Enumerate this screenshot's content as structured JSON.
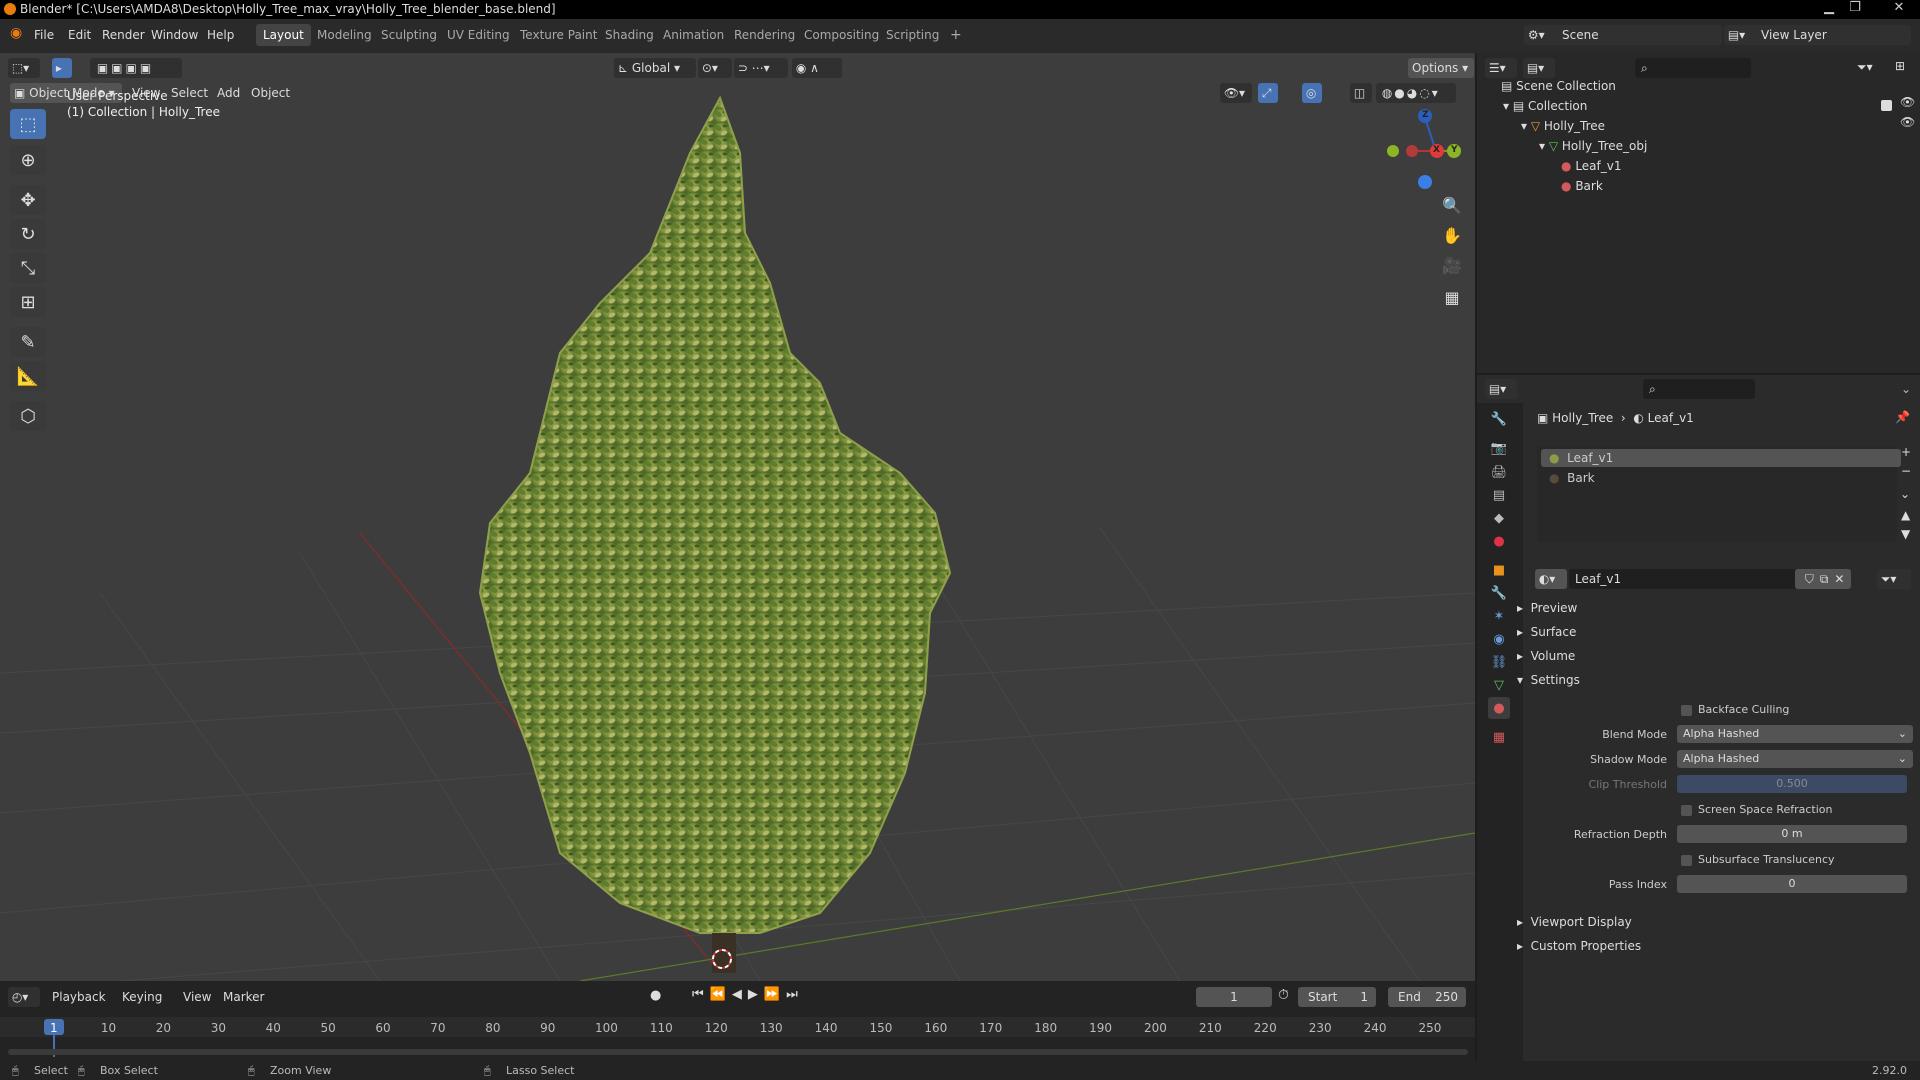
{
  "window": {
    "title": "Blender* [C:\\Users\\AMDA8\\Desktop\\Holly_Tree_max_vray\\Holly_Tree_blender_base.blend]"
  },
  "menus": [
    "File",
    "Edit",
    "Render",
    "Window",
    "Help"
  ],
  "workspaces": [
    "Layout",
    "Modeling",
    "Sculpting",
    "UV Editing",
    "Texture Paint",
    "Shading",
    "Animation",
    "Rendering",
    "Compositing",
    "Scripting"
  ],
  "scene": {
    "label": "Scene",
    "view_layer": "View Layer"
  },
  "viewport": {
    "transform": "Global",
    "options": "Options",
    "mode": "Object Mode",
    "menus": [
      "View",
      "Select",
      "Add",
      "Object"
    ],
    "overlay_line1": "User Perspective",
    "overlay_line2": "(1) Collection | Holly_Tree",
    "gizmo": {
      "z": "Z",
      "x": "X",
      "y": "Y"
    }
  },
  "outliner": {
    "root": "Scene Collection",
    "collection": "Collection",
    "object": "Holly_Tree",
    "mesh": "Holly_Tree_obj",
    "mat1": "Leaf_v1",
    "mat2": "Bark"
  },
  "properties": {
    "breadcrumb_object": "Holly_Tree",
    "breadcrumb_material": "Leaf_v1",
    "slots": [
      "Leaf_v1",
      "Bark"
    ],
    "material_name": "Leaf_v1",
    "sections": {
      "preview": "Preview",
      "surface": "Surface",
      "volume": "Volume",
      "settings": "Settings",
      "viewport_display": "Viewport Display",
      "custom_properties": "Custom Properties"
    },
    "backface_culling": "Backface Culling",
    "blend_mode_label": "Blend Mode",
    "blend_mode": "Alpha Hashed",
    "shadow_mode_label": "Shadow Mode",
    "shadow_mode": "Alpha Hashed",
    "clip_threshold_label": "Clip Threshold",
    "clip_threshold": "0.500",
    "ssr": "Screen Space Refraction",
    "refraction_depth_label": "Refraction Depth",
    "refraction_depth": "0 m",
    "subsurface": "Subsurface Translucency",
    "pass_index_label": "Pass Index",
    "pass_index": "0"
  },
  "timeline": {
    "menus": [
      "Playback",
      "Keying",
      "View",
      "Marker"
    ],
    "current_frame": "1",
    "start_label": "Start",
    "start": "1",
    "end_label": "End",
    "end": "250",
    "ticks": [
      "1",
      "10",
      "20",
      "30",
      "40",
      "50",
      "60",
      "70",
      "80",
      "90",
      "100",
      "110",
      "120",
      "130",
      "140",
      "150",
      "160",
      "170",
      "180",
      "190",
      "200",
      "210",
      "220",
      "230",
      "240",
      "250"
    ]
  },
  "status": {
    "select": "Select",
    "box_select": "Box Select",
    "zoom_view": "Zoom View",
    "lasso_select": "Lasso Select",
    "version": "2.92.0"
  },
  "colors": {
    "accent": "#4772b3",
    "orange": "#e87d0d",
    "leaf": "#7a8f3a"
  }
}
